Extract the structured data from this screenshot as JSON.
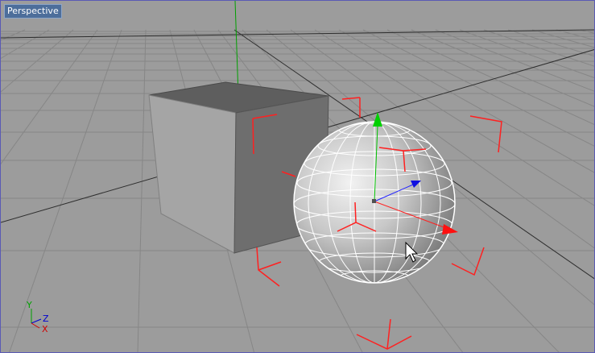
{
  "viewport": {
    "label": "Perspective"
  },
  "axis_indicator": {
    "y_label": "Y",
    "z_label": "Z",
    "x_label": "X"
  },
  "colors": {
    "grid": "#8a8a8a",
    "grid_major": "#3c3c3c",
    "background": "#9c9c9c",
    "selection_brackets": "#ff1a1a",
    "axis_x": "#ff0000",
    "axis_y": "#00c000",
    "axis_z": "#0000ff",
    "label_bg": "#4d6e9b"
  },
  "objects": [
    {
      "name": "cube",
      "type": "cube",
      "selected": false
    },
    {
      "name": "sphere",
      "type": "sphere",
      "selected": true
    }
  ],
  "cursor_icon": "pointer-arrow-icon"
}
